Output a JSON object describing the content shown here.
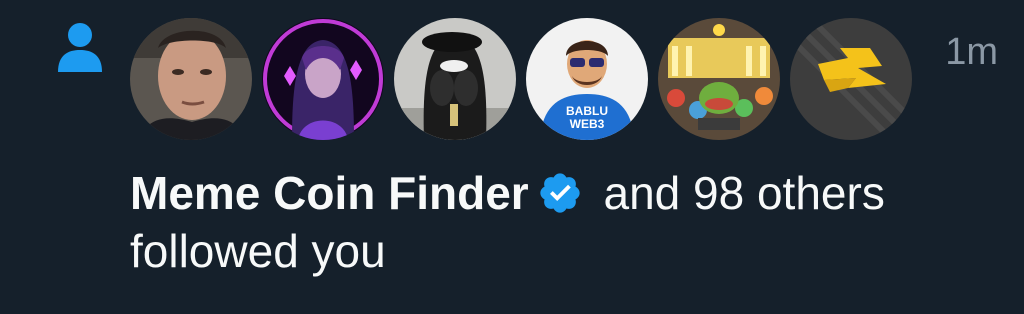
{
  "notification": {
    "type_icon": "person-icon",
    "accent_color": "#1d9bf0",
    "timestamp": "1m",
    "avatars": [
      {
        "icon": "avatar-photo-man"
      },
      {
        "icon": "avatar-neon-woman"
      },
      {
        "icon": "avatar-hooded-figure"
      },
      {
        "icon": "avatar-bablu-web3",
        "text": "BABLU\nWEB3"
      },
      {
        "icon": "avatar-meme-collage"
      },
      {
        "icon": "avatar-gold-logo"
      }
    ],
    "actor_name": "Meme Coin Finder",
    "verified_icon": "verified-badge-icon",
    "others_text": "and 98 others",
    "action_text": "followed you"
  }
}
